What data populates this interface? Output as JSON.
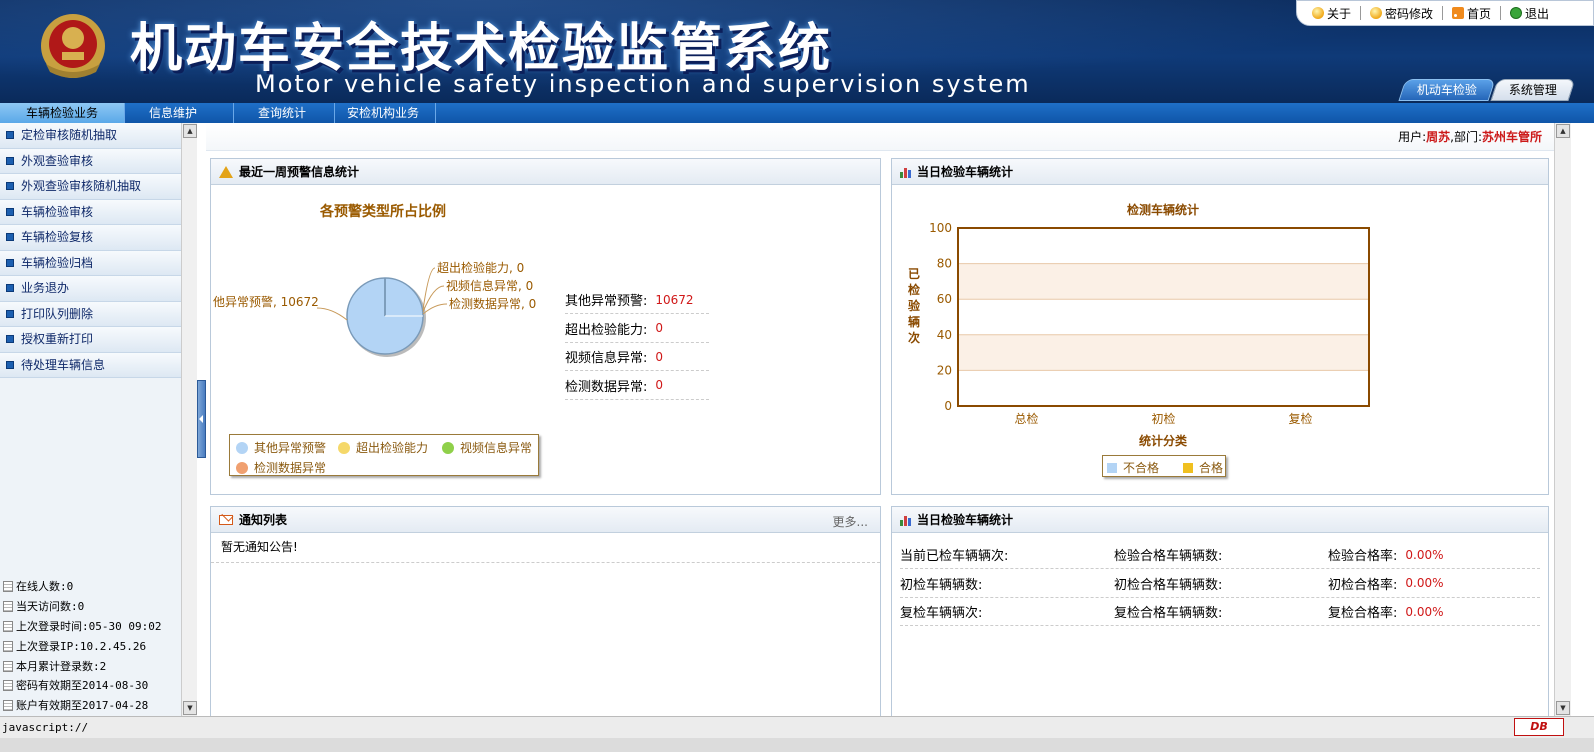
{
  "header": {
    "title_cn": "机动车安全技术检验监管系统",
    "title_en": "Motor vehicle safety inspection and supervision system",
    "top_links": [
      {
        "label": "关于",
        "icon": "bulb-icon"
      },
      {
        "label": "密码修改",
        "icon": "bulb-icon"
      },
      {
        "label": "首页",
        "icon": "rss-icon"
      },
      {
        "label": "退出",
        "icon": "exit-icon"
      }
    ],
    "system_tabs": [
      {
        "label": "机动车检验",
        "active": true
      },
      {
        "label": "系统管理",
        "active": false
      }
    ]
  },
  "nav": {
    "tabs": [
      {
        "label": "车辆检验业务",
        "active": true
      },
      {
        "label": "信息维护",
        "active": false
      },
      {
        "label": "查询统计",
        "active": false
      },
      {
        "label": "安检机构业务",
        "active": false
      }
    ]
  },
  "sidebar": {
    "menu": [
      "定检审核随机抽取",
      "外观查验审核",
      "外观查验审核随机抽取",
      "车辆检验审核",
      "车辆检验复核",
      "车辆检验归档",
      "业务退办",
      "打印队列删除",
      "授权重新打印",
      "待处理车辆信息"
    ],
    "stats": [
      "在线人数:0",
      "当天访问数:0",
      "上次登录时间:05-30 09:02",
      "上次登录IP:10.2.45.26",
      "本月累计登录数:2",
      "密码有效期至2014-08-30",
      "账户有效期至2017-04-28"
    ]
  },
  "userbar": {
    "user_label": "用户:",
    "user": "周苏",
    "dept_label": ",部门:",
    "dept": "苏州车管所"
  },
  "warning_panel": {
    "title": "最近一周预警信息统计",
    "items": [
      {
        "label": "其他异常预警:",
        "value": "10672"
      },
      {
        "label": "超出检验能力:",
        "value": "0"
      },
      {
        "label": "视频信息异常:",
        "value": "0"
      },
      {
        "label": "检测数据异常:",
        "value": "0"
      }
    ]
  },
  "daily_panel": {
    "title": "当日检验车辆统计"
  },
  "notice_panel": {
    "title": "通知列表",
    "more": "更多...",
    "empty": "暂无通知公告!"
  },
  "daily_stats_panel": {
    "title": "当日检验车辆统计",
    "rows": [
      [
        {
          "label": "当前已检车辆辆次:",
          "value": ""
        },
        {
          "label": "检验合格车辆辆数:",
          "value": ""
        },
        {
          "label": "检验合格率:",
          "value": "0.00%"
        }
      ],
      [
        {
          "label": "初检车辆辆数:",
          "value": ""
        },
        {
          "label": "初检合格车辆辆数:",
          "value": ""
        },
        {
          "label": "初检合格率:",
          "value": "0.00%"
        }
      ],
      [
        {
          "label": "复检车辆辆次:",
          "value": ""
        },
        {
          "label": "复检合格车辆辆数:",
          "value": ""
        },
        {
          "label": "复检合格率:",
          "value": "0.00%"
        }
      ]
    ]
  },
  "status_bar": {
    "text": "javascript://"
  },
  "chart_data": [
    {
      "type": "pie",
      "title": "各预警类型所占比例",
      "categories": [
        "其他异常预警",
        "超出检验能力",
        "视频信息异常",
        "检测数据异常"
      ],
      "values": [
        10672,
        0,
        0,
        0
      ],
      "slice_labels": [
        "他异常预警, 10672",
        "超出检验能力, 0",
        "视频信息异常, 0",
        "检测数据异常, 0"
      ],
      "colors": [
        "#b3d4f5",
        "#f5d86a",
        "#8fd04a",
        "#f0a070"
      ],
      "legend": "bottom-left"
    },
    {
      "type": "bar",
      "title": "检测车辆统计",
      "categories": [
        "总检",
        "初检",
        "复检"
      ],
      "series": [
        {
          "name": "不合格",
          "values": [
            0,
            0,
            0
          ],
          "color": "#b3d4f5"
        },
        {
          "name": "合格",
          "values": [
            0,
            0,
            0
          ],
          "color": "#f0c020"
        }
      ],
      "xlabel": "统计分类",
      "ylabel": "已检验辆次",
      "ylim": [
        0,
        100
      ],
      "yticks": [
        "0",
        "20",
        "40",
        "60",
        "80",
        "100"
      ],
      "legend": "bottom-center"
    }
  ]
}
